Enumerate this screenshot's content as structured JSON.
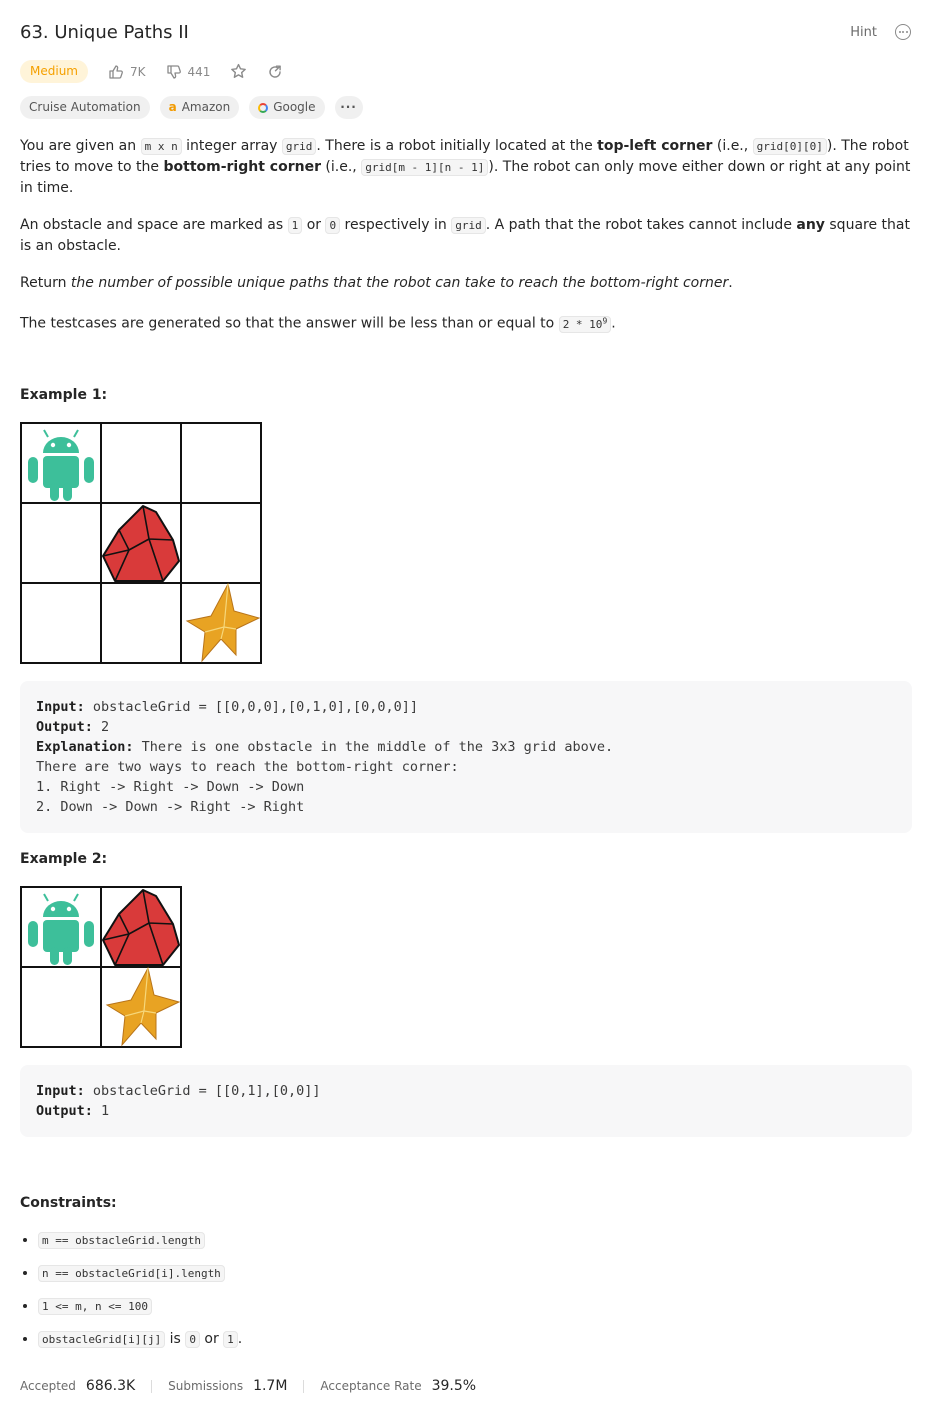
{
  "header": {
    "title": "63. Unique Paths II",
    "hint_label": "Hint"
  },
  "meta": {
    "difficulty": "Medium",
    "likes": "7K",
    "dislikes": "441"
  },
  "tags": [
    {
      "label": "Cruise Automation"
    },
    {
      "label": "Amazon"
    },
    {
      "label": "Google"
    },
    {
      "label": "···"
    }
  ],
  "description": {
    "p1": {
      "a": "You are given an ",
      "code_mn": "m x n",
      "b": " integer array ",
      "code_grid": "grid",
      "c": ". There is a robot initially located at the ",
      "bold_tl": "top-left corner",
      "d": " (i.e., ",
      "code_00": "grid[0][0]",
      "e": "). The robot tries to move to the ",
      "bold_br": "bottom-right corner",
      "f": " (i.e., ",
      "code_mn1": "grid[m - 1][n - 1]",
      "g": "). The robot can only move either down or right at any point in time."
    },
    "p2": {
      "a": "An obstacle and space are marked as ",
      "code_1": "1",
      "b": " or ",
      "code_0": "0",
      "c": " respectively in ",
      "code_grid": "grid",
      "d": ". A path that the robot takes cannot include ",
      "bold_any": "any",
      "e": " square that is an obstacle."
    },
    "p3": {
      "a": "Return ",
      "italic": "the number of possible unique paths that the robot can take to reach the bottom-right corner",
      "b": "."
    },
    "p4": {
      "a": "The testcases are generated so that the answer will be less than or equal to ",
      "code_base": "2 * 10",
      "code_exp": "9",
      "b": "."
    }
  },
  "example1": {
    "title": "Example 1:",
    "input_label": "Input:",
    "input_value": " obstacleGrid = [[0,0,0],[0,1,0],[0,0,0]]",
    "output_label": "Output:",
    "output_value": " 2",
    "explanation_label": "Explanation:",
    "explanation_value": " There is one obstacle in the middle of the 3x3 grid above.",
    "line2": "There are two ways to reach the bottom-right corner:",
    "line3": "1. Right -> Right -> Down -> Down",
    "line4": "2. Down -> Down -> Right -> Right"
  },
  "example2": {
    "title": "Example 2:",
    "input_label": "Input:",
    "input_value": " obstacleGrid = [[0,1],[0,0]]",
    "output_label": "Output:",
    "output_value": " 1"
  },
  "constraints": {
    "title": "Constraints:",
    "c1": "m == obstacleGrid.length",
    "c2": "n == obstacleGrid[i].length",
    "c3": "1 <= m, n <= 100",
    "c4_code": "obstacleGrid[i][j]",
    "c4_is": " is ",
    "c4_0": "0",
    "c4_or": " or ",
    "c4_1": "1",
    "c4_end": "."
  },
  "stats": {
    "accepted_label": "Accepted",
    "accepted_value": "686.3K",
    "submissions_label": "Submissions",
    "submissions_value": "1.7M",
    "rate_label": "Acceptance Rate",
    "rate_value": "39.5%"
  },
  "colors": {
    "robot": "#3dbf9a",
    "obstacle": "#d93a3a",
    "star": "#e8a323",
    "medium_text": "#f5a000",
    "medium_bg": "#fff4d9"
  }
}
